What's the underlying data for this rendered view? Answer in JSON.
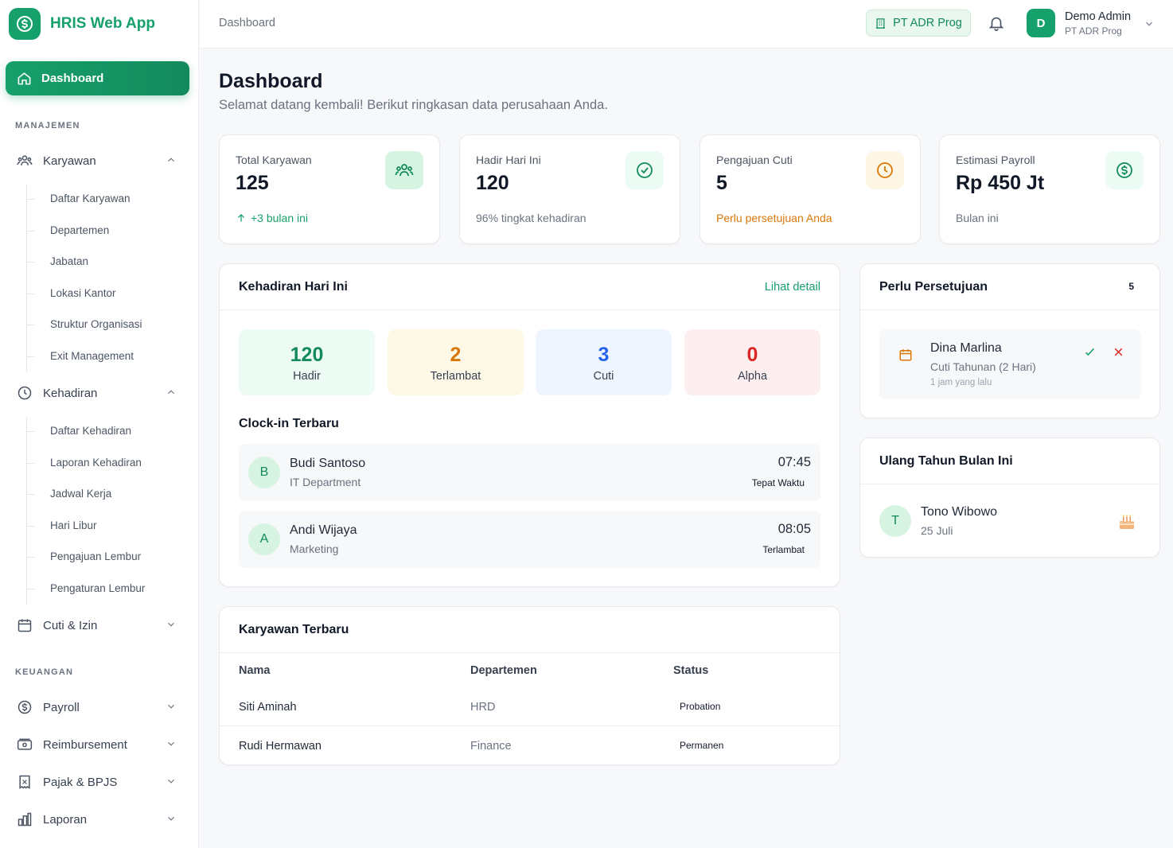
{
  "app": {
    "name": "HRIS Web App"
  },
  "sidebar": {
    "active": "Dashboard",
    "section_manajemen": "MANAJEMEN",
    "karyawan": {
      "label": "Karyawan",
      "items": [
        "Daftar Karyawan",
        "Departemen",
        "Jabatan",
        "Lokasi Kantor",
        "Struktur Organisasi",
        "Exit Management"
      ]
    },
    "kehadiran": {
      "label": "Kehadiran",
      "items": [
        "Daftar Kehadiran",
        "Laporan Kehadiran",
        "Jadwal Kerja",
        "Hari Libur",
        "Pengajuan Lembur",
        "Pengaturan Lembur"
      ]
    },
    "cuti": "Cuti & Izin",
    "section_keuangan": "KEUANGAN",
    "payroll": "Payroll",
    "reimbursement": "Reimbursement",
    "pajak": "Pajak & BPJS",
    "laporan": "Laporan"
  },
  "header": {
    "breadcrumb": "Dashboard",
    "company": "PT ADR Prog",
    "user_initial": "D",
    "user_name": "Demo Admin",
    "user_company": "PT ADR Prog"
  },
  "page": {
    "title": "Dashboard",
    "subtitle": "Selamat datang kembali! Berikut ringkasan data perusahaan Anda."
  },
  "stats": [
    {
      "label": "Total Karyawan",
      "value": "125",
      "foot": "+3 bulan ini",
      "color": "#16a06b"
    },
    {
      "label": "Hadir Hari Ini",
      "value": "120",
      "foot": "96% tingkat kehadiran",
      "color": "#6b7280"
    },
    {
      "label": "Pengajuan Cuti",
      "value": "5",
      "foot": "Perlu persetujuan Anda",
      "color": "#d97706"
    },
    {
      "label": "Estimasi Payroll",
      "value": "Rp 450 Jt",
      "foot": "Bulan ini",
      "color": "#6b7280"
    }
  ],
  "attendance": {
    "title": "Kehadiran Hari Ini",
    "link": "Lihat detail",
    "boxes": [
      {
        "num": "120",
        "label": "Hadir",
        "color": "#138a5d",
        "bg": "#ecfbf3"
      },
      {
        "num": "2",
        "label": "Terlambat",
        "color": "#d97706",
        "bg": "#fef9e7"
      },
      {
        "num": "3",
        "label": "Cuti",
        "color": "#2563eb",
        "bg": "#eef5fe"
      },
      {
        "num": "0",
        "label": "Alpha",
        "color": "#dc2626",
        "bg": "#fdeff0"
      }
    ],
    "clockin_title": "Clock-in Terbaru",
    "clockins": [
      {
        "initial": "B",
        "name": "Budi Santoso",
        "dept": "IT Department",
        "time": "07:45",
        "status": "Tepat Waktu"
      },
      {
        "initial": "A",
        "name": "Andi Wijaya",
        "dept": "Marketing",
        "time": "08:05",
        "status": "Terlambat"
      }
    ]
  },
  "approval": {
    "title": "Perlu Persetujuan",
    "count": "5",
    "item": {
      "name": "Dina Marlina",
      "type": "Cuti Tahunan (2 Hari)",
      "time": "1 jam yang lalu"
    }
  },
  "birthday": {
    "title": "Ulang Tahun Bulan Ini",
    "item": {
      "initial": "T",
      "name": "Tono Wibowo",
      "date": "25 Juli"
    }
  },
  "employees": {
    "title": "Karyawan Terbaru",
    "columns": [
      "Nama",
      "Departemen",
      "Status"
    ],
    "rows": [
      {
        "name": "Siti Aminah",
        "dept": "HRD",
        "status": "Probation"
      },
      {
        "name": "Rudi Hermawan",
        "dept": "Finance",
        "status": "Permanen"
      }
    ]
  }
}
